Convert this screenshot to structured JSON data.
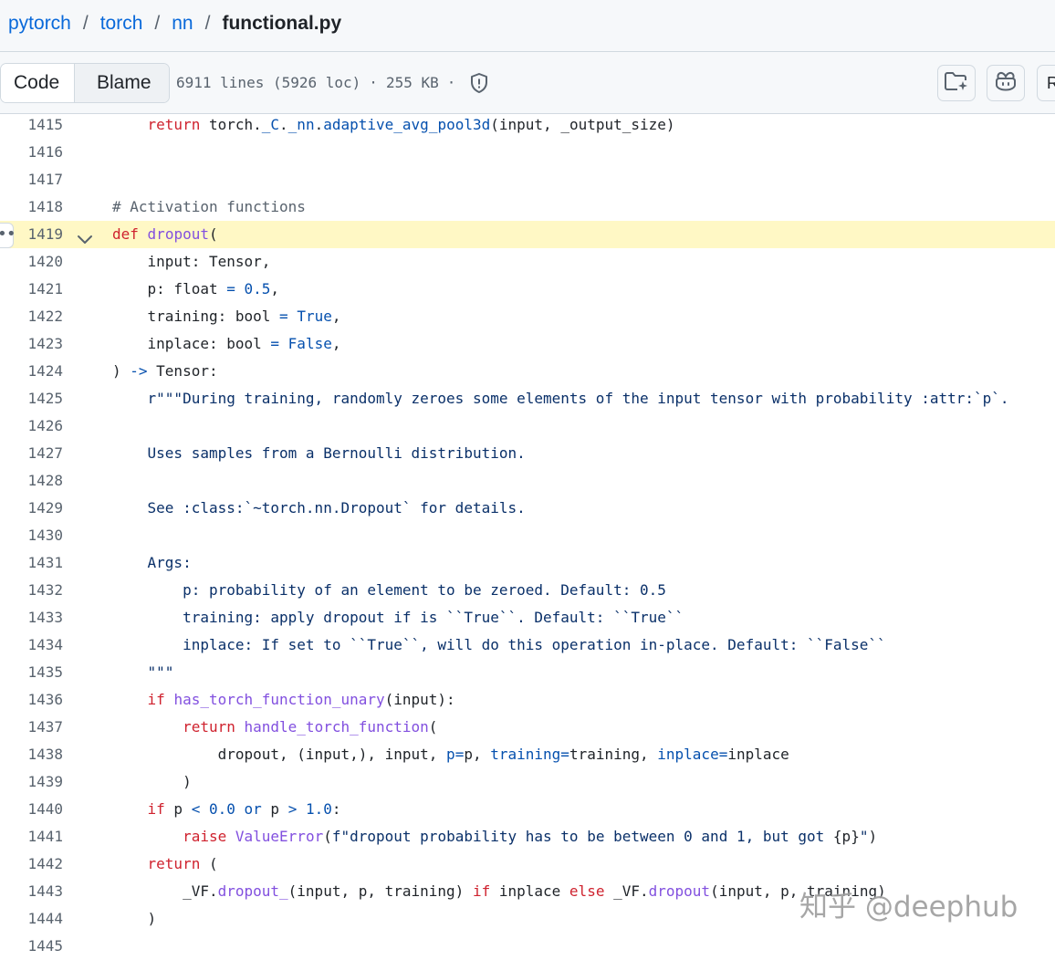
{
  "breadcrumb": {
    "repo": "pytorch",
    "dir1": "torch",
    "dir2": "nn",
    "file": "functional.py",
    "separator": "/"
  },
  "toolbar": {
    "code_tab": "Code",
    "blame_tab": "Blame",
    "line_info": "6911 lines (5926 loc)",
    "size": "255 KB",
    "dot": "·",
    "icons": [
      "shield-icon",
      "file-directory-icon",
      "copilot-icon"
    ],
    "cut_button_label": "R"
  },
  "code_lines": [
    {
      "n": "1415",
      "t": "    <span class='k'>return</span> torch.<span class='n'>_C</span>.<span class='n'>_nn</span>.<span class='n'>adaptive_avg_pool3d</span>(input, _output_size)"
    },
    {
      "n": "1416",
      "t": ""
    },
    {
      "n": "1417",
      "t": ""
    },
    {
      "n": "1418",
      "t": "<span class='c'># Activation functions</span>"
    },
    {
      "n": "1419",
      "t": "<span class='k'>def</span> <span class='f'>dropout</span>("
    },
    {
      "n": "1420",
      "t": "    input: Tensor,"
    },
    {
      "n": "1421",
      "t": "    p: float <span class='o'>=</span> <span class='n'>0.5</span>,"
    },
    {
      "n": "1422",
      "t": "    training: bool <span class='o'>=</span> <span class='n'>True</span>,"
    },
    {
      "n": "1423",
      "t": "    inplace: bool <span class='o'>=</span> <span class='n'>False</span>,"
    },
    {
      "n": "1424",
      "t": ") <span class='o'>-&gt;</span> Tensor:"
    },
    {
      "n": "1425",
      "t": "    <span class='s'>r\"\"\"During training, randomly zeroes some elements of the input tensor with probability :attr:`p`.</span>"
    },
    {
      "n": "1426",
      "t": ""
    },
    {
      "n": "1427",
      "t": "<span class='s'>    Uses samples from a Bernoulli distribution.</span>"
    },
    {
      "n": "1428",
      "t": ""
    },
    {
      "n": "1429",
      "t": "<span class='s'>    See :class:`~torch.nn.Dropout` for details.</span>"
    },
    {
      "n": "1430",
      "t": ""
    },
    {
      "n": "1431",
      "t": "<span class='s'>    Args:</span>"
    },
    {
      "n": "1432",
      "t": "<span class='s'>        p: probability of an element to be zeroed. Default: 0.5</span>"
    },
    {
      "n": "1433",
      "t": "<span class='s'>        training: apply dropout if is ``True``. Default: ``True``</span>"
    },
    {
      "n": "1434",
      "t": "<span class='s'>        inplace: If set to ``True``, will do this operation in-place. Default: ``False``</span>"
    },
    {
      "n": "1435",
      "t": "<span class='s'>    \"\"\"</span>"
    },
    {
      "n": "1436",
      "t": "    <span class='k'>if</span> <span class='f'>has_torch_function_unary</span>(input):"
    },
    {
      "n": "1437",
      "t": "        <span class='k'>return</span> <span class='f'>handle_torch_function</span>("
    },
    {
      "n": "1438",
      "t": "            dropout, (input,), input, <span class='n'>p</span><span class='o'>=</span>p, <span class='n'>training</span><span class='o'>=</span>training, <span class='n'>inplace</span><span class='o'>=</span>inplace"
    },
    {
      "n": "1439",
      "t": "        )"
    },
    {
      "n": "1440",
      "t": "    <span class='k'>if</span> p <span class='o'>&lt;</span> <span class='n'>0.0</span> <span class='o'>or</span> p <span class='o'>&gt;</span> <span class='n'>1.0</span>:"
    },
    {
      "n": "1441",
      "t": "        <span class='k'>raise</span> <span class='f'>ValueError</span>(<span class='s'>f\"dropout probability has to be between 0 and 1, but got </span>{p}<span class='s'>\"</span>)"
    },
    {
      "n": "1442",
      "t": "    <span class='k'>return</span> ("
    },
    {
      "n": "1443",
      "t": "        _VF.<span class='f'>dropout_</span>(input, p, training) <span class='k'>if</span> inplace <span class='k'>else</span> _VF.<span class='f'>dropout</span>(input, p, training)"
    },
    {
      "n": "1444",
      "t": "    )"
    },
    {
      "n": "1445",
      "t": ""
    }
  ],
  "highlighted_line": "1419",
  "watermark": "知乎 @deephub",
  "colors": {
    "link": "#0969da",
    "keyword": "#cf222e",
    "function": "#8250df",
    "string": "#0a3069",
    "constant": "#0550ae",
    "comment": "#59636e",
    "highlight": "#fff8c5"
  }
}
